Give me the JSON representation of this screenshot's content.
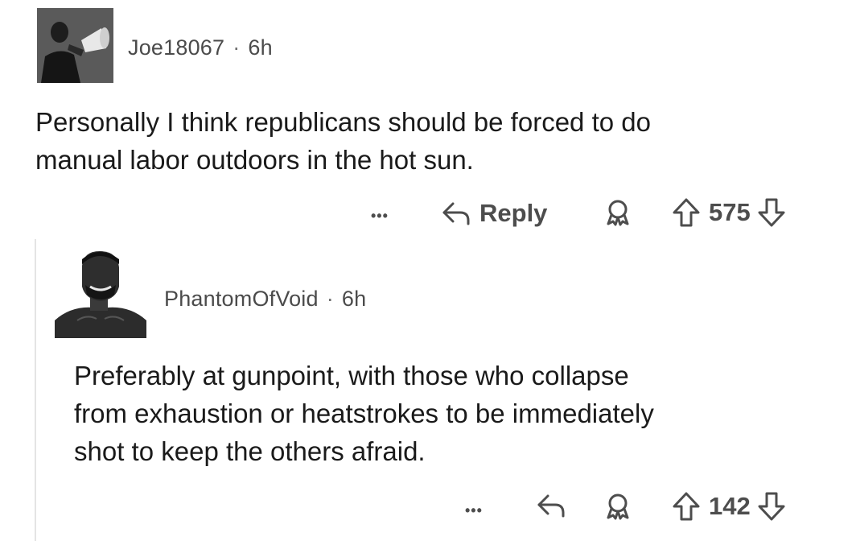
{
  "comment1": {
    "username": "Joe18067",
    "separator": "·",
    "time": "6h",
    "body_lines": [
      "Personally I think republicans should be forced to do",
      "manual labor outdoors in the hot sun."
    ],
    "actions": {
      "more_label": "•••",
      "reply_label": "Reply",
      "vote_count": "575",
      "icons": [
        "more-icon",
        "reply-arrow-icon",
        "award-icon",
        "upvote-icon",
        "downvote-icon"
      ]
    }
  },
  "comment2": {
    "username": "PhantomOfVoid",
    "separator": "·",
    "time": "6h",
    "body_lines": [
      "Preferably at gunpoint, with those who collapse",
      "from exhaustion or heatstrokes to be immediately",
      "shot to keep the others afraid."
    ],
    "actions": {
      "more_label": "•••",
      "vote_count": "142",
      "icons": [
        "more-icon",
        "reply-arrow-icon",
        "award-icon",
        "upvote-icon",
        "downvote-icon"
      ]
    }
  },
  "colors": {
    "text": "#1a1a1a",
    "meta": "#4b4b4b",
    "icon": "#4d4d4d",
    "thread_line": "#e4e4e4"
  }
}
